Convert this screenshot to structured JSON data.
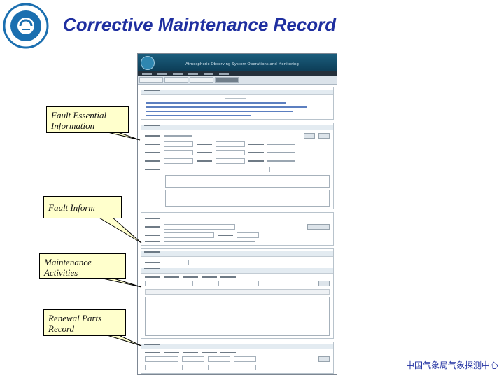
{
  "slide": {
    "title": "Corrective Maintenance Record",
    "footer": "中国气象局气象探测中心"
  },
  "callouts": {
    "fault_essential": "Fault Essential Information",
    "fault_inform": "Fault Inform",
    "maintenance": "Maintenance Activities",
    "renewal": "Renewal Parts Record"
  },
  "app": {
    "title_en": "Atmospheric Observing System Operations and Monitoring"
  },
  "colors": {
    "title_blue": "#1f2fa0",
    "callout_fill": "#ffffcc",
    "app_header": "#1b5e7d"
  }
}
